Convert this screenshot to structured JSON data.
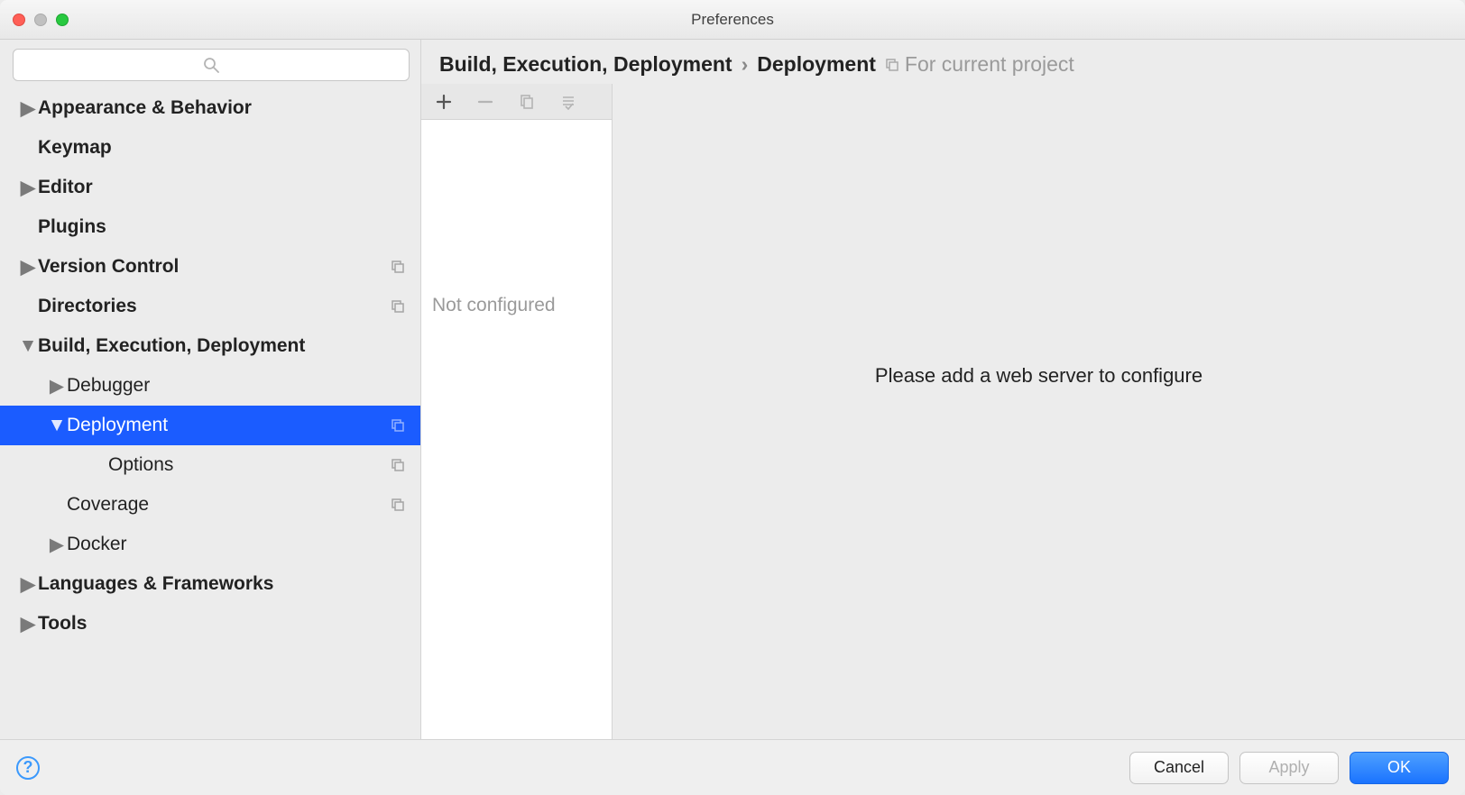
{
  "window": {
    "title": "Preferences"
  },
  "search": {
    "placeholder": ""
  },
  "sidebar": {
    "items": [
      {
        "label": "Appearance & Behavior"
      },
      {
        "label": "Keymap"
      },
      {
        "label": "Editor"
      },
      {
        "label": "Plugins"
      },
      {
        "label": "Version Control"
      },
      {
        "label": "Directories"
      },
      {
        "label": "Build, Execution, Deployment"
      },
      {
        "label": "Debugger"
      },
      {
        "label": "Deployment"
      },
      {
        "label": "Options"
      },
      {
        "label": "Coverage"
      },
      {
        "label": "Docker"
      },
      {
        "label": "Languages & Frameworks"
      },
      {
        "label": "Tools"
      }
    ]
  },
  "breadcrumb": {
    "part1": "Build, Execution, Deployment",
    "sep": "›",
    "part2": "Deployment",
    "meta": "For current project"
  },
  "list": {
    "empty_text": "Not configured"
  },
  "detail": {
    "empty_msg": "Please add a web server to configure"
  },
  "footer": {
    "cancel": "Cancel",
    "apply": "Apply",
    "ok": "OK"
  }
}
